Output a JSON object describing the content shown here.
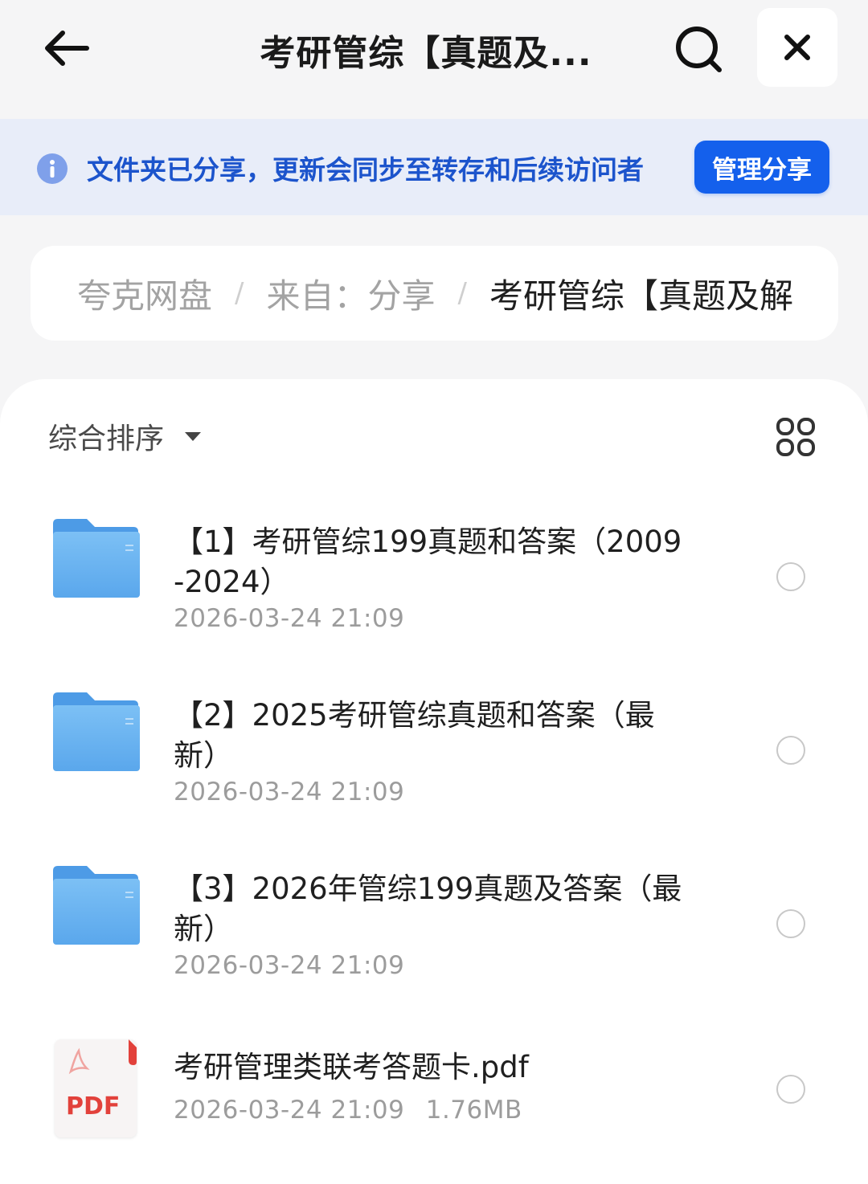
{
  "header": {
    "title": "考研管综【真题及...",
    "icons": {
      "back": "arrow-left-icon",
      "search": "search-icon",
      "close": "close-icon"
    }
  },
  "banner": {
    "text": "文件夹已分享，更新会同步至转存和后续访问者",
    "button_label": "管理分享",
    "icon": "info-icon"
  },
  "breadcrumb": [
    {
      "label": "夸克网盘"
    },
    {
      "label": "来自：分享"
    },
    {
      "label": "考研管综【真题及解"
    }
  ],
  "toolbar": {
    "sort_label": "综合排序",
    "view_toggle_icon": "grid-view-icon"
  },
  "files": [
    {
      "type": "folder",
      "name": "【1】考研管综199真题和答案（2009-2024）",
      "date": "2026-03-24 21:09"
    },
    {
      "type": "folder",
      "name": "【2】2025考研管综真题和答案（最新）",
      "date": "2026-03-24 21:09"
    },
    {
      "type": "folder",
      "name": "【3】2026年管综199真题及答案（最新）",
      "date": "2026-03-24 21:09"
    },
    {
      "type": "pdf",
      "name": "考研管理类联考答题卡.pdf",
      "date": "2026-03-24 21:09",
      "size": "1.76MB",
      "icon_label": "PDF"
    }
  ],
  "colors": {
    "accent": "#1460ec",
    "banner_bg": "#e8edf9",
    "banner_text": "#1c54cc",
    "folder": "#6cb3f0",
    "pdf_red": "#e2413b"
  }
}
